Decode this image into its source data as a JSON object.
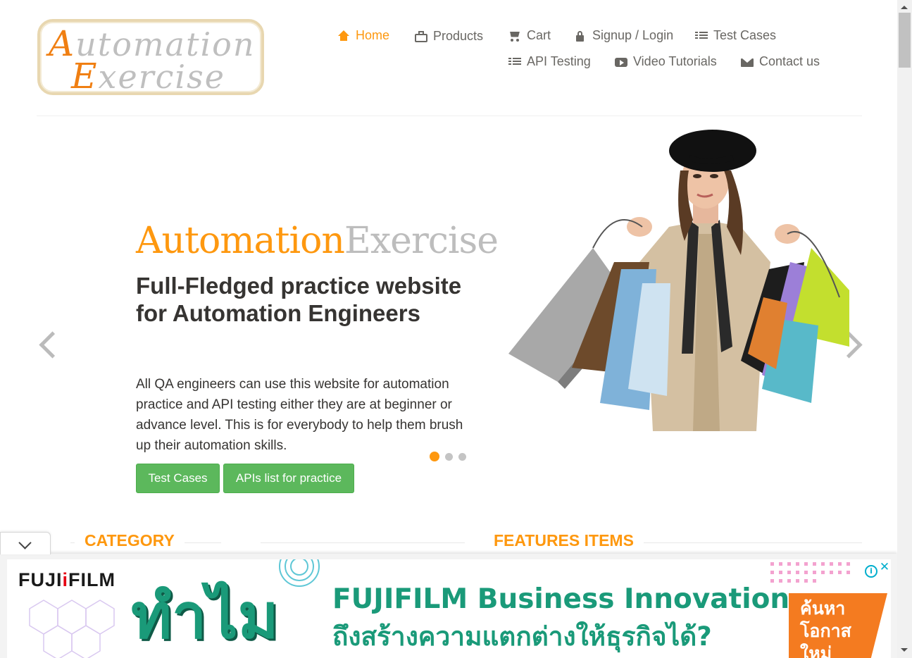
{
  "brand": {
    "logo_line1_cap": "A",
    "logo_line1_rest": "utomation",
    "logo_line2_cap": "E",
    "logo_line2_rest": "xercise"
  },
  "nav": {
    "home": "Home",
    "products": "Products",
    "cart": "Cart",
    "signup_login": "Signup / Login",
    "test_cases": "Test Cases",
    "api_testing": "API Testing",
    "video_tutorials": "Video Tutorials",
    "contact_us": "Contact us",
    "active_item": "Home",
    "active_color": "#fe980f"
  },
  "slider": {
    "brand_orange": "Automation",
    "brand_grey": "Exercise",
    "heading": "Full-Fledged practice website for Automation Engineers",
    "text": "All QA engineers can use this website for automation practice and API testing either they are at beginner or advance level. This is for everybody to help them brush up their automation skills.",
    "btn_test_cases": "Test Cases",
    "btn_apis": "APIs list for practice",
    "slide_count": 3,
    "active_slide": 1
  },
  "sections": {
    "category": "CATEGORY",
    "features_items": "FEATURES ITEMS"
  },
  "ad": {
    "brand_left": "FUJI",
    "brand_i": "i",
    "brand_right": "FILM",
    "thai_big": "ทำไม",
    "line1": "FUJIFILM Business Innovation",
    "line2": "ถึงสร้างความแตกต่างให้ธุรกิจได้?",
    "cta": "ค้นหา โอกาส ใหม่",
    "info_icon": "i",
    "close_icon": "✕"
  },
  "colors": {
    "accent": "#fe980f",
    "button_green": "#5cb85c",
    "text_dark": "#363432",
    "nav_text": "#696763",
    "ad_green": "#1a9a79",
    "ad_orange": "#f47b20"
  }
}
